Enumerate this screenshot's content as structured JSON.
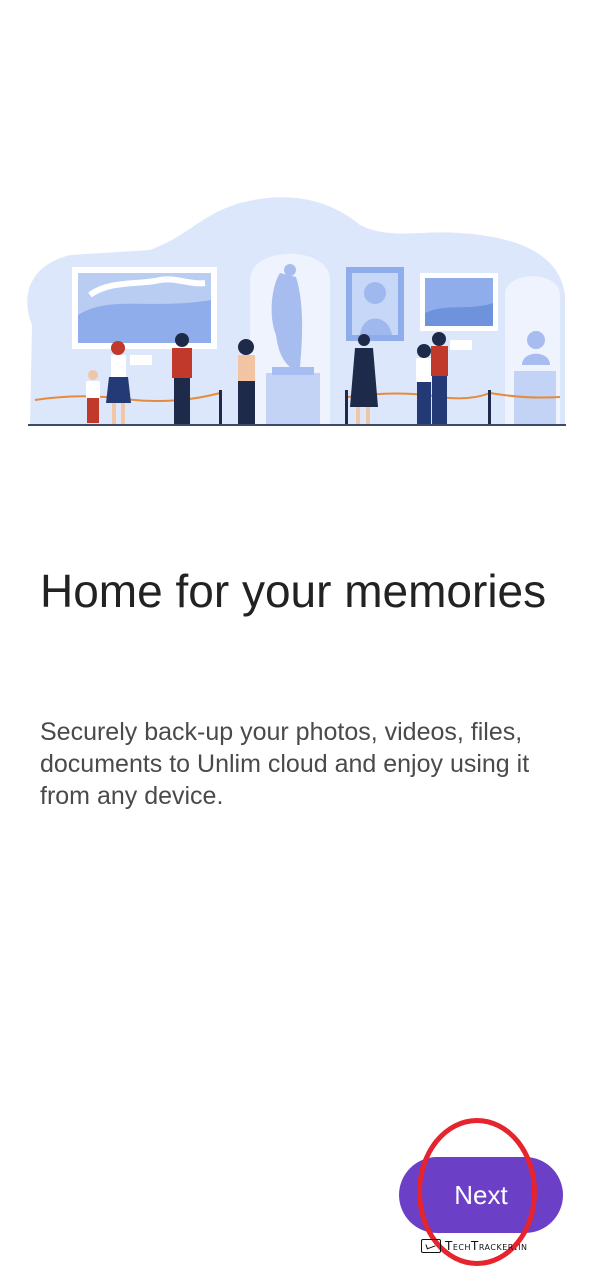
{
  "onboarding": {
    "title": "Home for your memories",
    "description": "Securely back-up your photos, videos, files, documents to Unlim cloud and enjoy using it from any device.",
    "next_label": "Next"
  },
  "watermark": {
    "text": "TechTracker.in"
  },
  "colors": {
    "accent": "#6c3fc7",
    "illustration_blue": "#d9e4fb",
    "annotation_red": "#e5242e"
  }
}
